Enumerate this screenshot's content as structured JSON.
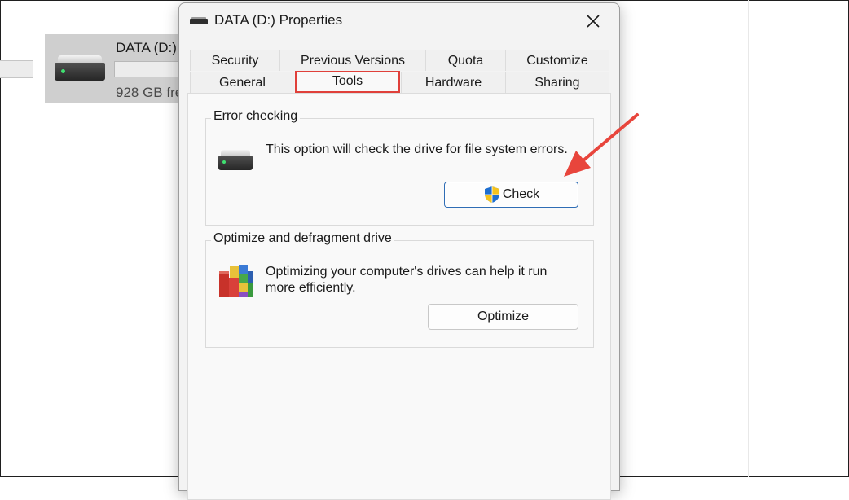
{
  "background": {
    "drive_name": "DATA (D:)",
    "drive_free_text": "928 GB fre"
  },
  "dialog": {
    "title": "DATA (D:) Properties",
    "close_icon": "close-icon",
    "tabs_row1": [
      "Security",
      "Previous Versions",
      "Quota",
      "Customize"
    ],
    "tabs_row2": [
      "General",
      "Tools",
      "Hardware",
      "Sharing"
    ],
    "selected_tab": "Tools"
  },
  "error_checking": {
    "label": "Error checking",
    "description": "This option will check the drive for file system errors.",
    "button_label": "Check",
    "icon": "hard-drive-icon",
    "button_icon": "uac-shield-icon"
  },
  "optimize": {
    "label": "Optimize and defragment drive",
    "description": "Optimizing your computer's drives can help it run more efficiently.",
    "button_label": "Optimize",
    "icon": "defragment-icon"
  },
  "colors": {
    "annotation_red": "#e8453c",
    "primary_button_border": "#2f6db5",
    "dialog_bg": "#f3f3f3",
    "panel_bg": "#f9f9f9"
  }
}
